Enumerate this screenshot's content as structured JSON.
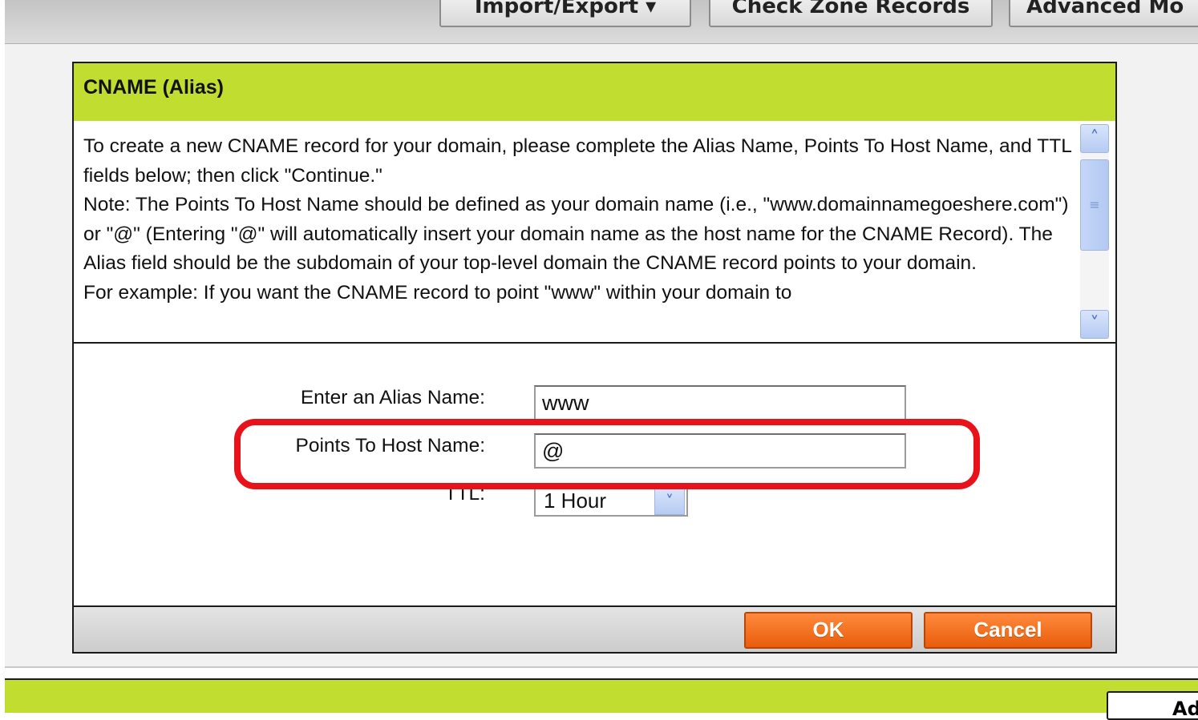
{
  "toolbar": {
    "buttons": [
      "Import/Export ▾",
      "Check Zone Records",
      "Advanced Mo"
    ]
  },
  "dialog": {
    "title": "CNAME (Alias)",
    "description": [
      "To create a new CNAME record for your domain, please complete the Alias Name, Points To Host Name, and TTL fields below; then click \"Continue.\"",
      "Note: The Points To Host Name should be defined as your domain name (i.e., \"www.domainnamegoeshere.com\") or \"@\" (Entering \"@\" will automatically insert your domain name as the host name for the CNAME Record). The Alias field should be the subdomain of your top-level domain the CNAME record points to your domain.",
      "For example: If you want the CNAME record to point \"www\" within your domain to"
    ],
    "form": {
      "alias_label": "Enter an Alias Name:",
      "alias_value": "www",
      "host_label": "Points To Host Name:",
      "host_value": "@",
      "ttl_label": "TTL:",
      "ttl_value": "1 Hour"
    },
    "ok_label": "OK",
    "cancel_label": "Cancel"
  },
  "corner_button_label": "Ad",
  "colors": {
    "header_green": "#c1dd2f",
    "button_orange": "#f26f1e",
    "highlight_red": "#e8121b"
  }
}
